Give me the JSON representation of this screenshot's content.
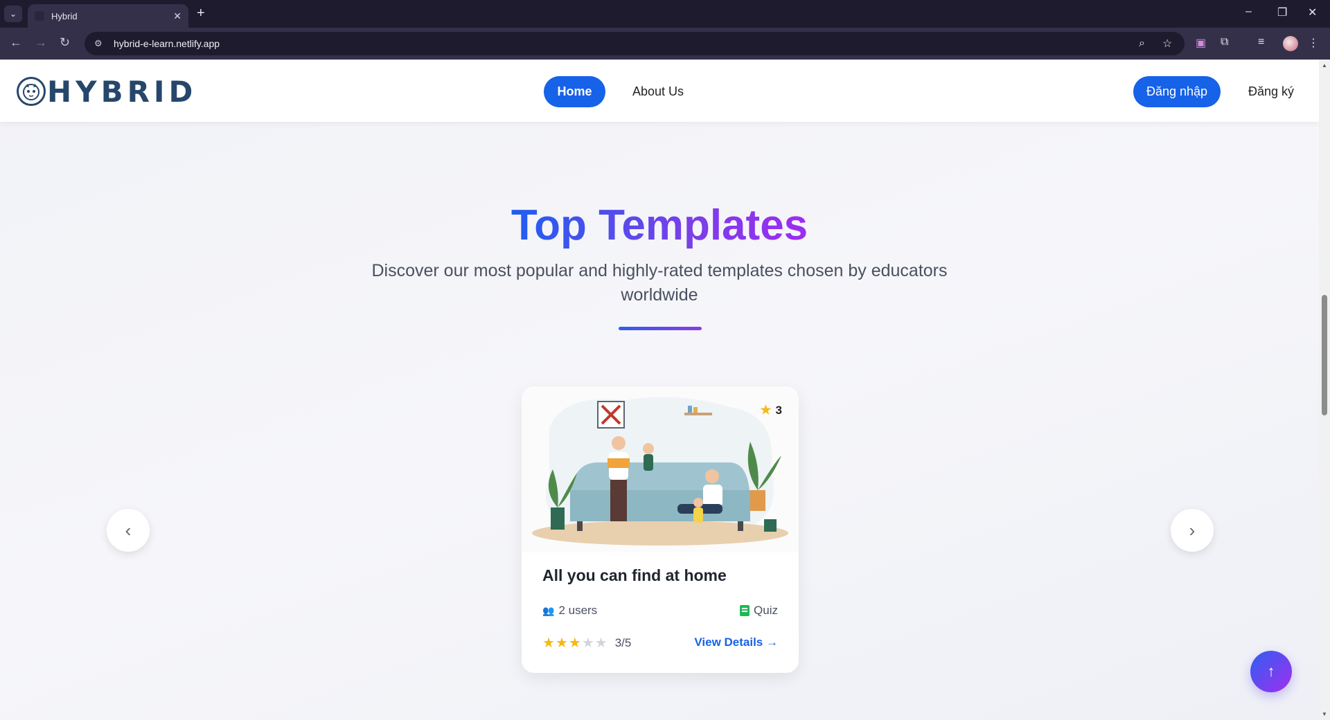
{
  "browser": {
    "tab_title": "Hybrid",
    "url": "hybrid-e-learn.netlify.app"
  },
  "header": {
    "logo_text": "HYBRID",
    "nav": [
      {
        "label": "Home",
        "active": true
      },
      {
        "label": "About Us",
        "active": false
      }
    ],
    "login_label": "Đăng nhập",
    "register_label": "Đăng ký"
  },
  "section": {
    "title": "Top Templates",
    "subtitle": "Discover our most popular and highly-rated templates chosen by educators worldwide"
  },
  "card": {
    "badge_rating": "3",
    "title": "All you can find at home",
    "users": "2 users",
    "type": "Quiz",
    "stars_filled": 3,
    "stars_total": 5,
    "score": "3/5",
    "view_details": "View Details →"
  },
  "colors": {
    "primary": "#1662e8",
    "gradient_start": "#1f5ef0",
    "gradient_end": "#9d2cf2",
    "star": "#f5b914"
  }
}
